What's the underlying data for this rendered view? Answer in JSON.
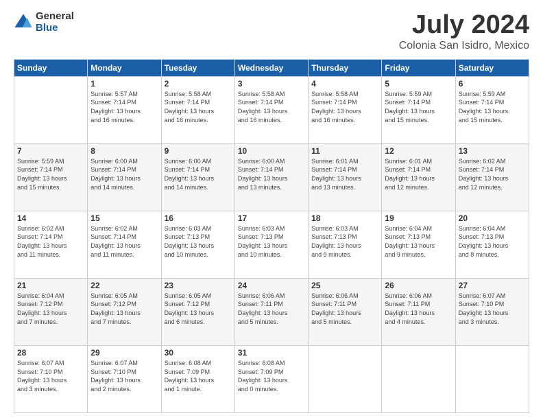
{
  "logo": {
    "general": "General",
    "blue": "Blue"
  },
  "header": {
    "title": "July 2024",
    "subtitle": "Colonia San Isidro, Mexico"
  },
  "columns": [
    "Sunday",
    "Monday",
    "Tuesday",
    "Wednesday",
    "Thursday",
    "Friday",
    "Saturday"
  ],
  "weeks": [
    [
      {
        "day": "",
        "info": ""
      },
      {
        "day": "1",
        "info": "Sunrise: 5:57 AM\nSunset: 7:14 PM\nDaylight: 13 hours\nand 16 minutes."
      },
      {
        "day": "2",
        "info": "Sunrise: 5:58 AM\nSunset: 7:14 PM\nDaylight: 13 hours\nand 16 minutes."
      },
      {
        "day": "3",
        "info": "Sunrise: 5:58 AM\nSunset: 7:14 PM\nDaylight: 13 hours\nand 16 minutes."
      },
      {
        "day": "4",
        "info": "Sunrise: 5:58 AM\nSunset: 7:14 PM\nDaylight: 13 hours\nand 16 minutes."
      },
      {
        "day": "5",
        "info": "Sunrise: 5:59 AM\nSunset: 7:14 PM\nDaylight: 13 hours\nand 15 minutes."
      },
      {
        "day": "6",
        "info": "Sunrise: 5:59 AM\nSunset: 7:14 PM\nDaylight: 13 hours\nand 15 minutes."
      }
    ],
    [
      {
        "day": "7",
        "info": "Sunrise: 5:59 AM\nSunset: 7:14 PM\nDaylight: 13 hours\nand 15 minutes."
      },
      {
        "day": "8",
        "info": "Sunrise: 6:00 AM\nSunset: 7:14 PM\nDaylight: 13 hours\nand 14 minutes."
      },
      {
        "day": "9",
        "info": "Sunrise: 6:00 AM\nSunset: 7:14 PM\nDaylight: 13 hours\nand 14 minutes."
      },
      {
        "day": "10",
        "info": "Sunrise: 6:00 AM\nSunset: 7:14 PM\nDaylight: 13 hours\nand 13 minutes."
      },
      {
        "day": "11",
        "info": "Sunrise: 6:01 AM\nSunset: 7:14 PM\nDaylight: 13 hours\nand 13 minutes."
      },
      {
        "day": "12",
        "info": "Sunrise: 6:01 AM\nSunset: 7:14 PM\nDaylight: 13 hours\nand 12 minutes."
      },
      {
        "day": "13",
        "info": "Sunrise: 6:02 AM\nSunset: 7:14 PM\nDaylight: 13 hours\nand 12 minutes."
      }
    ],
    [
      {
        "day": "14",
        "info": "Sunrise: 6:02 AM\nSunset: 7:14 PM\nDaylight: 13 hours\nand 11 minutes."
      },
      {
        "day": "15",
        "info": "Sunrise: 6:02 AM\nSunset: 7:14 PM\nDaylight: 13 hours\nand 11 minutes."
      },
      {
        "day": "16",
        "info": "Sunrise: 6:03 AM\nSunset: 7:13 PM\nDaylight: 13 hours\nand 10 minutes."
      },
      {
        "day": "17",
        "info": "Sunrise: 6:03 AM\nSunset: 7:13 PM\nDaylight: 13 hours\nand 10 minutes."
      },
      {
        "day": "18",
        "info": "Sunrise: 6:03 AM\nSunset: 7:13 PM\nDaylight: 13 hours\nand 9 minutes."
      },
      {
        "day": "19",
        "info": "Sunrise: 6:04 AM\nSunset: 7:13 PM\nDaylight: 13 hours\nand 9 minutes."
      },
      {
        "day": "20",
        "info": "Sunrise: 6:04 AM\nSunset: 7:13 PM\nDaylight: 13 hours\nand 8 minutes."
      }
    ],
    [
      {
        "day": "21",
        "info": "Sunrise: 6:04 AM\nSunset: 7:12 PM\nDaylight: 13 hours\nand 7 minutes."
      },
      {
        "day": "22",
        "info": "Sunrise: 6:05 AM\nSunset: 7:12 PM\nDaylight: 13 hours\nand 7 minutes."
      },
      {
        "day": "23",
        "info": "Sunrise: 6:05 AM\nSunset: 7:12 PM\nDaylight: 13 hours\nand 6 minutes."
      },
      {
        "day": "24",
        "info": "Sunrise: 6:06 AM\nSunset: 7:11 PM\nDaylight: 13 hours\nand 5 minutes."
      },
      {
        "day": "25",
        "info": "Sunrise: 6:06 AM\nSunset: 7:11 PM\nDaylight: 13 hours\nand 5 minutes."
      },
      {
        "day": "26",
        "info": "Sunrise: 6:06 AM\nSunset: 7:11 PM\nDaylight: 13 hours\nand 4 minutes."
      },
      {
        "day": "27",
        "info": "Sunrise: 6:07 AM\nSunset: 7:10 PM\nDaylight: 13 hours\nand 3 minutes."
      }
    ],
    [
      {
        "day": "28",
        "info": "Sunrise: 6:07 AM\nSunset: 7:10 PM\nDaylight: 13 hours\nand 3 minutes."
      },
      {
        "day": "29",
        "info": "Sunrise: 6:07 AM\nSunset: 7:10 PM\nDaylight: 13 hours\nand 2 minutes."
      },
      {
        "day": "30",
        "info": "Sunrise: 6:08 AM\nSunset: 7:09 PM\nDaylight: 13 hours\nand 1 minute."
      },
      {
        "day": "31",
        "info": "Sunrise: 6:08 AM\nSunset: 7:09 PM\nDaylight: 13 hours\nand 0 minutes."
      },
      {
        "day": "",
        "info": ""
      },
      {
        "day": "",
        "info": ""
      },
      {
        "day": "",
        "info": ""
      }
    ]
  ]
}
